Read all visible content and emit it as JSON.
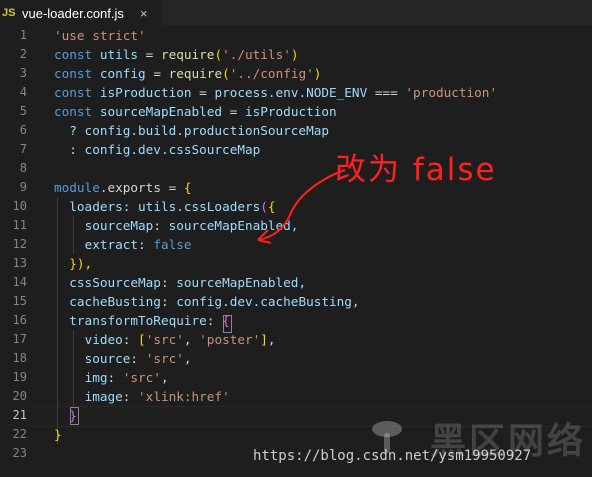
{
  "tab": {
    "icon": "JS",
    "title": "vue-loader.conf.js",
    "close": "×"
  },
  "lines": [
    {
      "n": "1"
    },
    {
      "n": "2"
    },
    {
      "n": "3"
    },
    {
      "n": "4"
    },
    {
      "n": "5"
    },
    {
      "n": "6"
    },
    {
      "n": "7"
    },
    {
      "n": "8"
    },
    {
      "n": "9"
    },
    {
      "n": "10"
    },
    {
      "n": "11"
    },
    {
      "n": "12"
    },
    {
      "n": "13"
    },
    {
      "n": "14"
    },
    {
      "n": "15"
    },
    {
      "n": "16"
    },
    {
      "n": "17"
    },
    {
      "n": "18"
    },
    {
      "n": "19"
    },
    {
      "n": "20"
    },
    {
      "n": "21"
    },
    {
      "n": "22"
    },
    {
      "n": "23"
    }
  ],
  "code": {
    "l1": "'use strict'",
    "l2": {
      "kw": "const",
      "name": "utils",
      "eq": " = ",
      "fn": "require",
      "arg": "'./utils'"
    },
    "l3": {
      "kw": "const",
      "name": "config",
      "eq": " = ",
      "fn": "require",
      "arg": "'../config'"
    },
    "l4": {
      "kw": "const",
      "name": "isProduction",
      "eq": " = ",
      "expr": "process.env.NODE_ENV",
      "op": " === ",
      "str": "'production'"
    },
    "l5": {
      "kw": "const",
      "name": "sourceMapEnabled",
      "eq": " = ",
      "expr": "isProduction"
    },
    "l6": "? config.build.productionSourceMap",
    "l7": ": config.dev.cssSourceMap",
    "l9": {
      "a": "module",
      "b": ".exports = "
    },
    "l10": {
      "key": "loaders",
      "val": "utils.cssLoaders"
    },
    "l11": {
      "key": "sourceMap",
      "val": "sourceMapEnabled,"
    },
    "l12": {
      "key": "extract",
      "val": "false"
    },
    "l13": "}),",
    "l14": {
      "key": "cssSourceMap",
      "val": "sourceMapEnabled,"
    },
    "l15": {
      "key": "cacheBusting",
      "val": "config.dev.cacheBusting,"
    },
    "l16": {
      "key": "transformToRequire"
    },
    "l17": {
      "key": "video",
      "s1": "'src'",
      "s2": "'poster'"
    },
    "l18": {
      "key": "source",
      "s1": "'src'"
    },
    "l19": {
      "key": "img",
      "s1": "'src'"
    },
    "l20": {
      "key": "image",
      "s1": "'xlink:href'"
    },
    "l22": "}"
  },
  "annotation": {
    "text": "改为 false",
    "color": "#ff2020"
  },
  "watermark": {
    "cn": "黑区网络",
    "url": "https://blog.csdn.net/ysm19950927"
  }
}
